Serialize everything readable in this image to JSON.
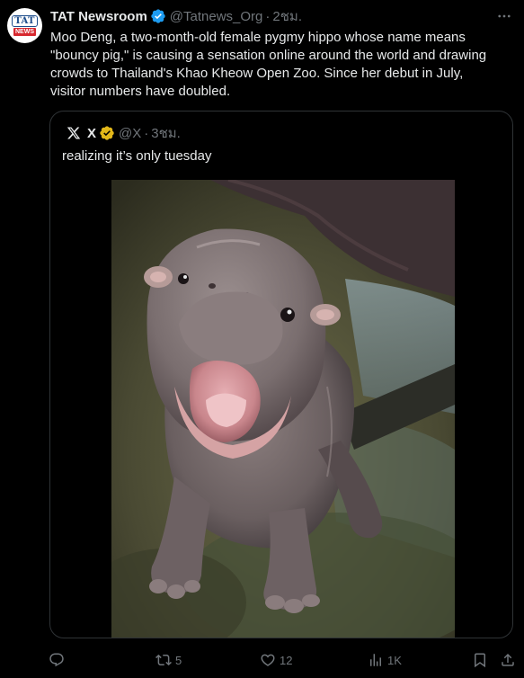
{
  "tweet": {
    "display_name": "TAT Newsroom",
    "handle": "@Tatnews_Org",
    "separator": "·",
    "time": "2ชม.",
    "text": "Moo Deng, a two-month-old female pygmy hippo whose name means \"bouncy pig,\" is causing a sensation online around the world and drawing crowds to Thailand's Khao Kheow Open Zoo. Since her debut in July, visitor numbers have doubled.",
    "avatar": {
      "logo_top": "TAT",
      "logo_bottom": "NEWS"
    },
    "more_icon": "more-horizontal-icon"
  },
  "quote": {
    "display_name": "X",
    "handle": "@X",
    "separator": "·",
    "time": "3ชม.",
    "text": "realizing it’s only tuesday"
  },
  "actions": {
    "reply": {
      "icon": "reply-icon",
      "count": ""
    },
    "retweet": {
      "icon": "retweet-icon",
      "count": "5"
    },
    "like": {
      "icon": "heart-icon",
      "count": "12"
    },
    "views": {
      "icon": "analytics-icon",
      "count": "1K"
    },
    "bookmark": {
      "icon": "bookmark-icon"
    },
    "share": {
      "icon": "share-icon"
    }
  },
  "colors": {
    "background": "#000000",
    "text_primary": "#e7e9ea",
    "text_secondary": "#71767b",
    "border": "#2f3336",
    "verified_blue": "#1d9bf0",
    "verified_gold": "#e2b719"
  }
}
